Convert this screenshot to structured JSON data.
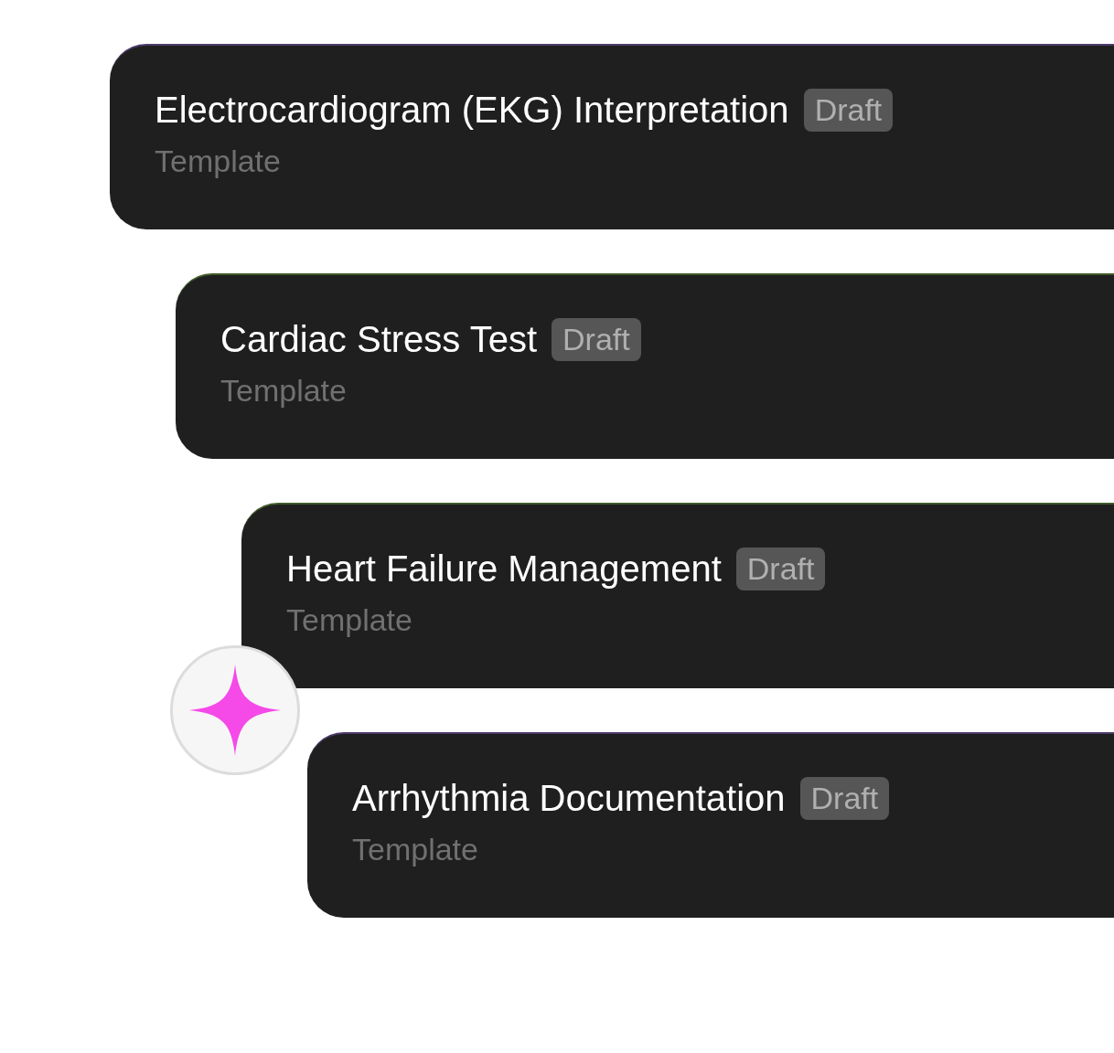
{
  "cards": [
    {
      "title": "Electrocardiogram (EKG) Interpretation",
      "badge": "Draft",
      "subtitle": "Template"
    },
    {
      "title": "Cardiac Stress Test",
      "badge": "Draft",
      "subtitle": "Template"
    },
    {
      "title": "Heart Failure Management",
      "badge": "Draft",
      "subtitle": "Template"
    },
    {
      "title": "Arrhythmia Documentation",
      "badge": "Draft",
      "subtitle": "Template"
    }
  ]
}
